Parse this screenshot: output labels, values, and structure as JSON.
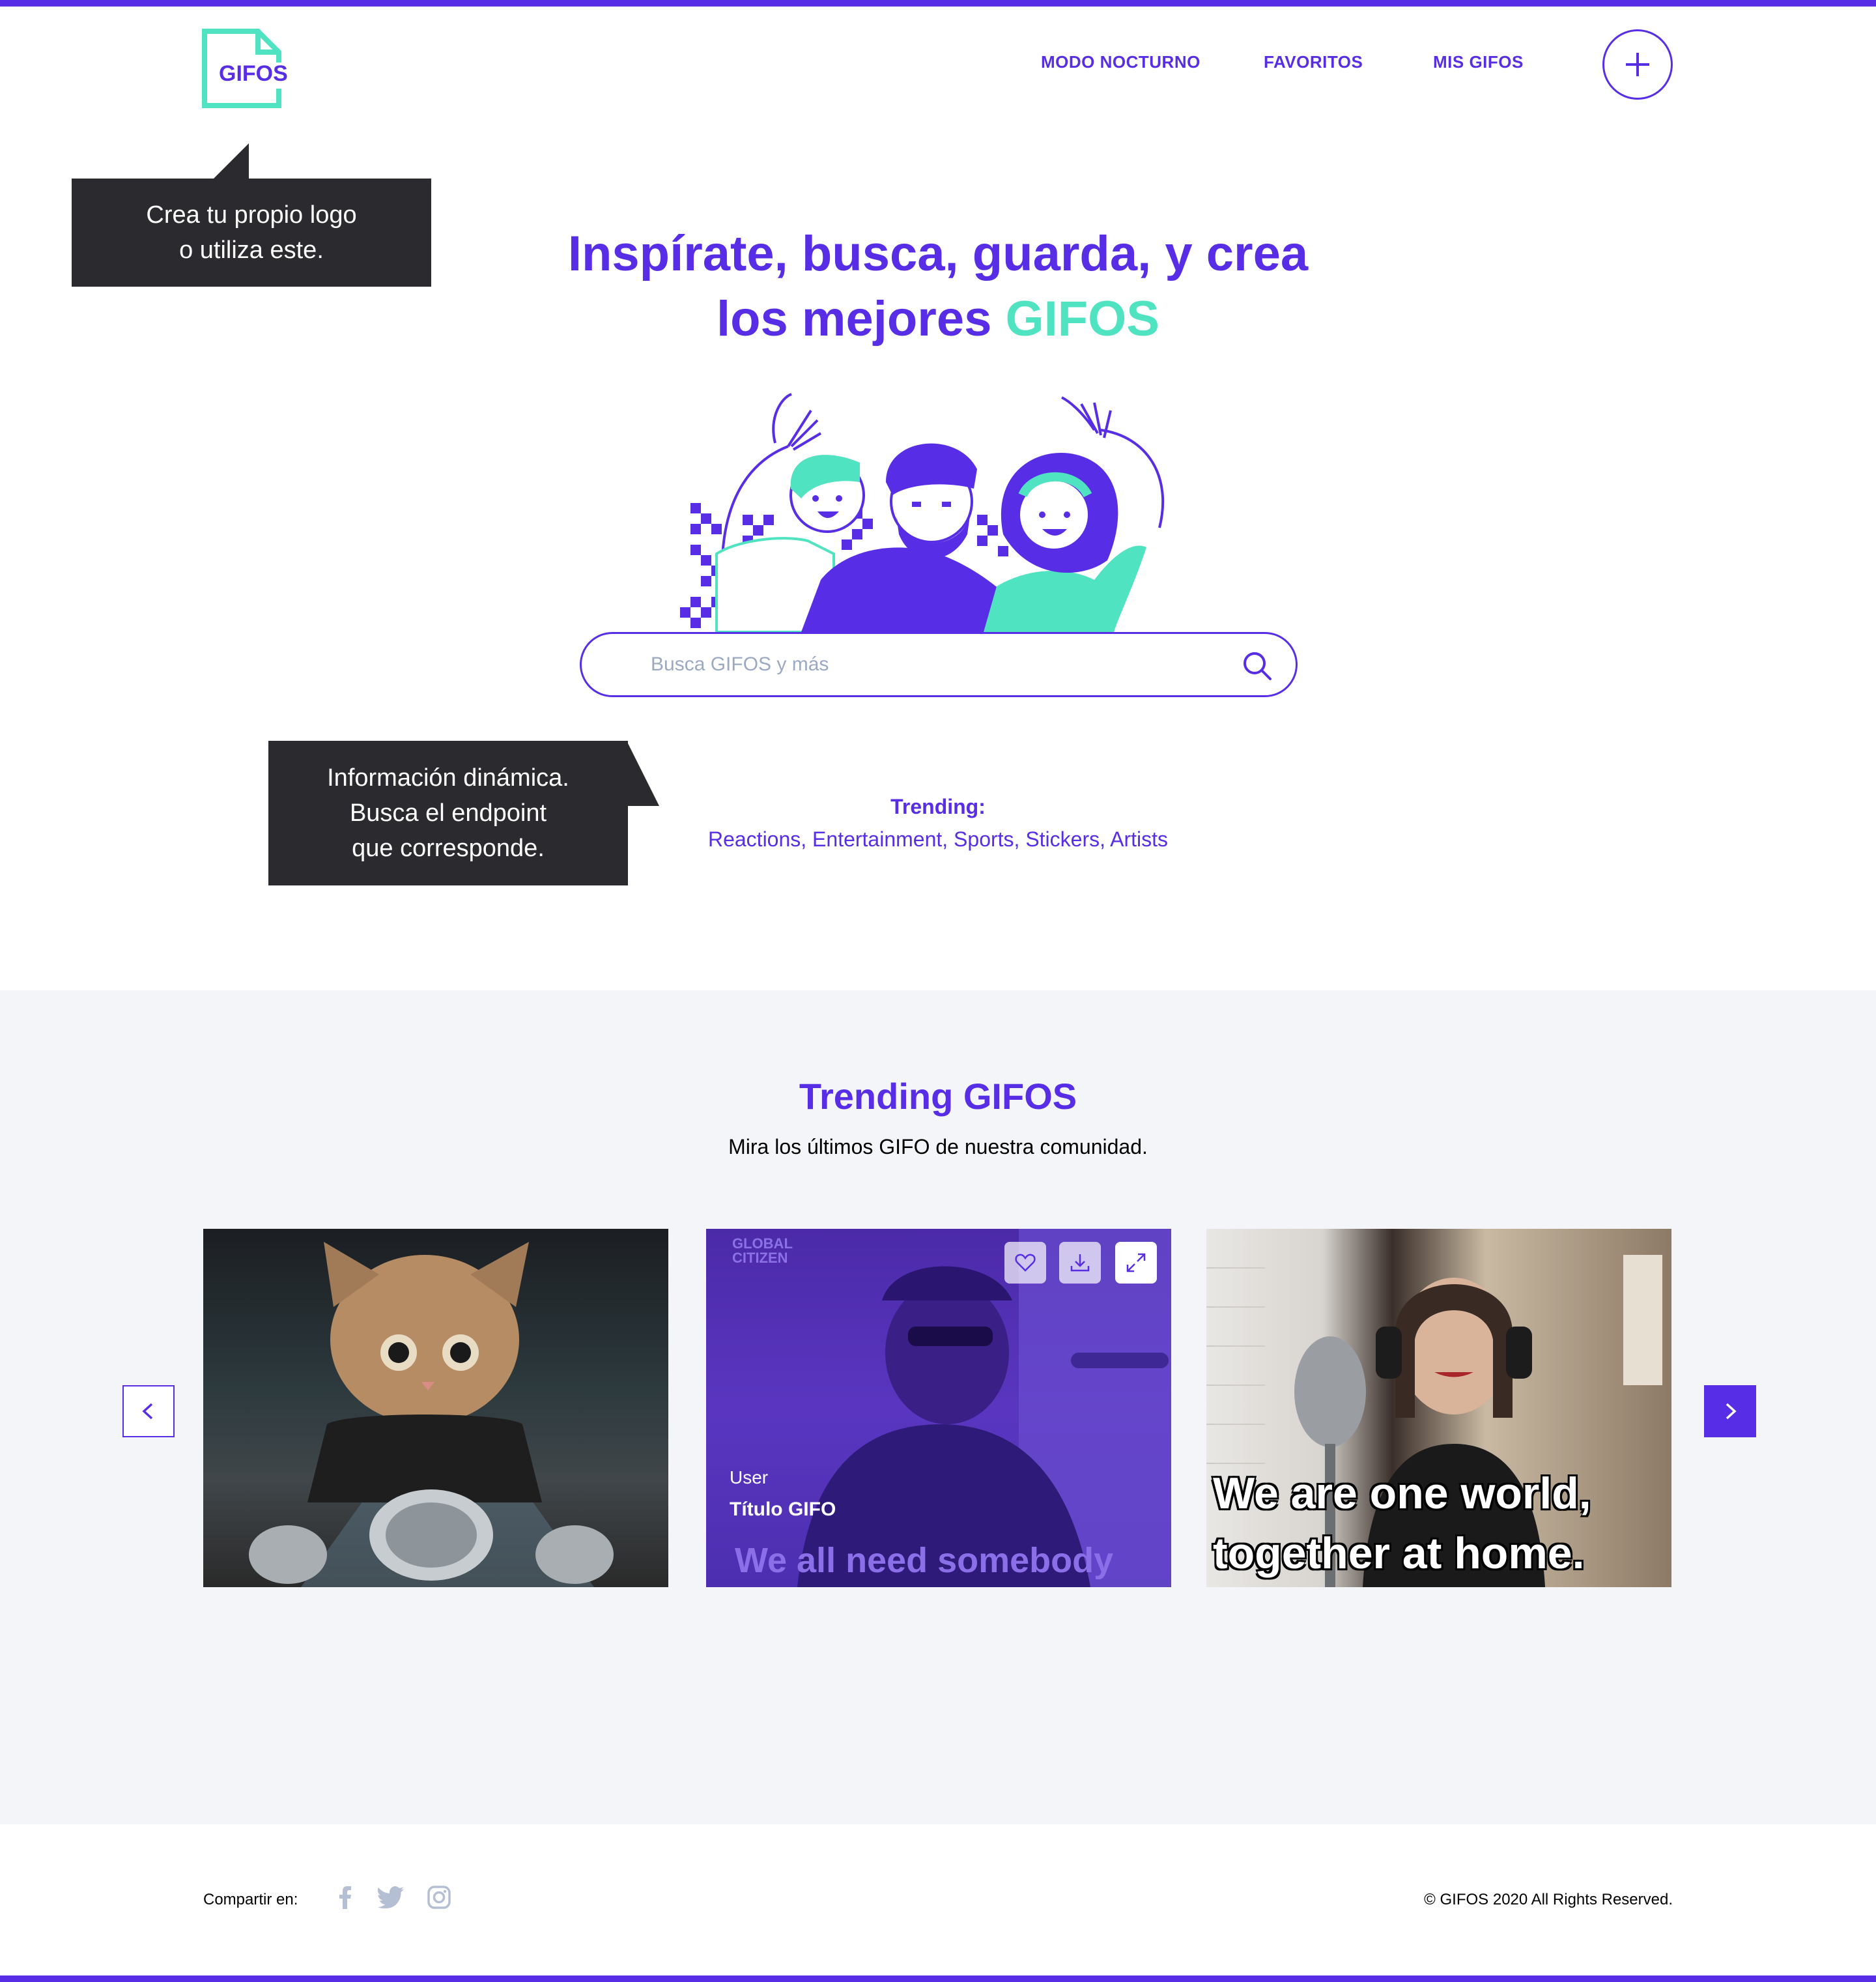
{
  "header": {
    "logo_text": "GIFOS",
    "nav": [
      "MODO NOCTURNO",
      "FAVORITOS",
      "MIS GIFOS"
    ]
  },
  "tooltips": {
    "logo_line1": "Crea tu propio logo",
    "logo_line2": "o utiliza este.",
    "info_line1": "Información dinámica.",
    "info_line2": "Busca el endpoint",
    "info_line3": "que corresponde."
  },
  "hero": {
    "title_line1": "Inspírate, busca, guarda, y crea",
    "title_line2_prefix": "los mejores ",
    "title_line2_accent": "GIFOS"
  },
  "search": {
    "placeholder": "Busca GIFOS y más"
  },
  "trending": {
    "label": "Trending:",
    "terms": "Reactions, Entertainment, Sports, Stickers, Artists"
  },
  "trending_section": {
    "title": "Trending GIFOS",
    "subtitle": "Mira los últimos GIFO de nuestra comunidad.",
    "card2": {
      "user": "User",
      "title": "Título GIFO",
      "caption": "We all need somebody",
      "watermark": "GLOBAL CITIZEN"
    },
    "card3": {
      "caption_line1": "We are one world,",
      "caption_line2": "together at home."
    }
  },
  "footer": {
    "share_label": "Compartir en:",
    "copyright": "© GIFOS 2020 All Rights Reserved."
  },
  "colors": {
    "primary": "#572ee5",
    "accent": "#50e3c2",
    "tooltip_bg": "#2b2a2e",
    "section_bg": "#f3f5f8"
  },
  "icons": [
    "plus-icon",
    "search-icon",
    "heart-icon",
    "download-icon",
    "expand-icon",
    "chevron-left-icon",
    "chevron-right-icon",
    "facebook-icon",
    "twitter-icon",
    "instagram-icon"
  ]
}
